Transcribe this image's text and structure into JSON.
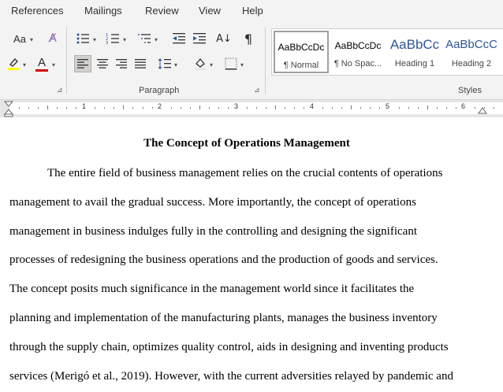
{
  "ribbon_tabs": [
    "References",
    "Mailings",
    "Review",
    "View",
    "Help"
  ],
  "toolbar": {
    "font_size_label": "Aa",
    "font_color_letter": "A",
    "paragraph_label": "Paragraph",
    "styles_label": "Styles",
    "highlight_color": "#ffff00",
    "font_color": "#d00000"
  },
  "styles": [
    {
      "preview": "AaBbCcDc",
      "name": "¶ Normal",
      "selected": true
    },
    {
      "preview": "AaBbCcDc",
      "name": "¶ No Spac...",
      "selected": false
    },
    {
      "preview": "AaBbCc",
      "name": "Heading 1",
      "selected": false
    },
    {
      "preview": "AaBbCcC",
      "name": "Heading 2",
      "selected": false
    }
  ],
  "ruler_numbers": [
    "1",
    "2",
    "3",
    "4",
    "5",
    "6"
  ],
  "document": {
    "title": "The Concept of Operations Management",
    "lines": [
      "The entire field of business management relies on the crucial contents of operations",
      "management to avail the gradual success. More importantly, the concept of operations",
      "management in business indulges fully in the controlling and designing the significant",
      "processes of redesigning the business operations and the production of goods and services.",
      "The concept posits much significance in the management world since it facilitates the",
      "planning and implementation of the manufacturing plants, manages the business inventory",
      "through the supply chain, optimizes quality control, aids in designing and inventing products",
      "services (Merigó et al., 2019). However, with the current adversities relayed by pandemic and"
    ]
  }
}
